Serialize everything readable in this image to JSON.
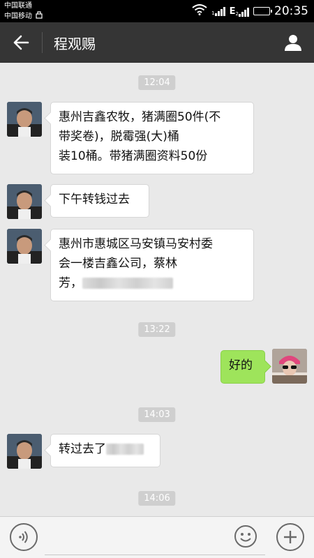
{
  "status_bar": {
    "carrier1": "中国联通",
    "carrier2": "中国移动",
    "sim1": "1",
    "network": "E",
    "sim2": "2",
    "time": "20:35",
    "battery_level": 1.0,
    "battery_color": "#46c030"
  },
  "header": {
    "back_icon": "back-arrow-icon",
    "title": "程观赐",
    "profile_icon": "person-icon"
  },
  "messages": [
    {
      "type": "timestamp",
      "text": "12:04"
    },
    {
      "type": "incoming",
      "lines": [
        "惠州吉鑫农牧，猪满圈50件(不",
        "带奖卷)，脱霉强(大)桶",
        "装10桶。带猪满圈资料50份"
      ]
    },
    {
      "type": "incoming",
      "lines": [
        "下午转钱过去"
      ]
    },
    {
      "type": "incoming",
      "lines": [
        "惠州市惠城区马安镇马安村委",
        "会一楼吉鑫公司，蔡林",
        "芳，"
      ],
      "redacted": true
    },
    {
      "type": "timestamp",
      "text": "13:22"
    },
    {
      "type": "outgoing",
      "lines": [
        "好的"
      ]
    },
    {
      "type": "timestamp",
      "text": "14:03"
    },
    {
      "type": "incoming",
      "lines": [
        "转过去了"
      ],
      "redacted": true
    },
    {
      "type": "timestamp",
      "text": "14:06"
    }
  ],
  "input_bar": {
    "voice_icon": "voice-icon",
    "emoji_icon": "emoji-icon",
    "plus_icon": "plus-icon"
  }
}
